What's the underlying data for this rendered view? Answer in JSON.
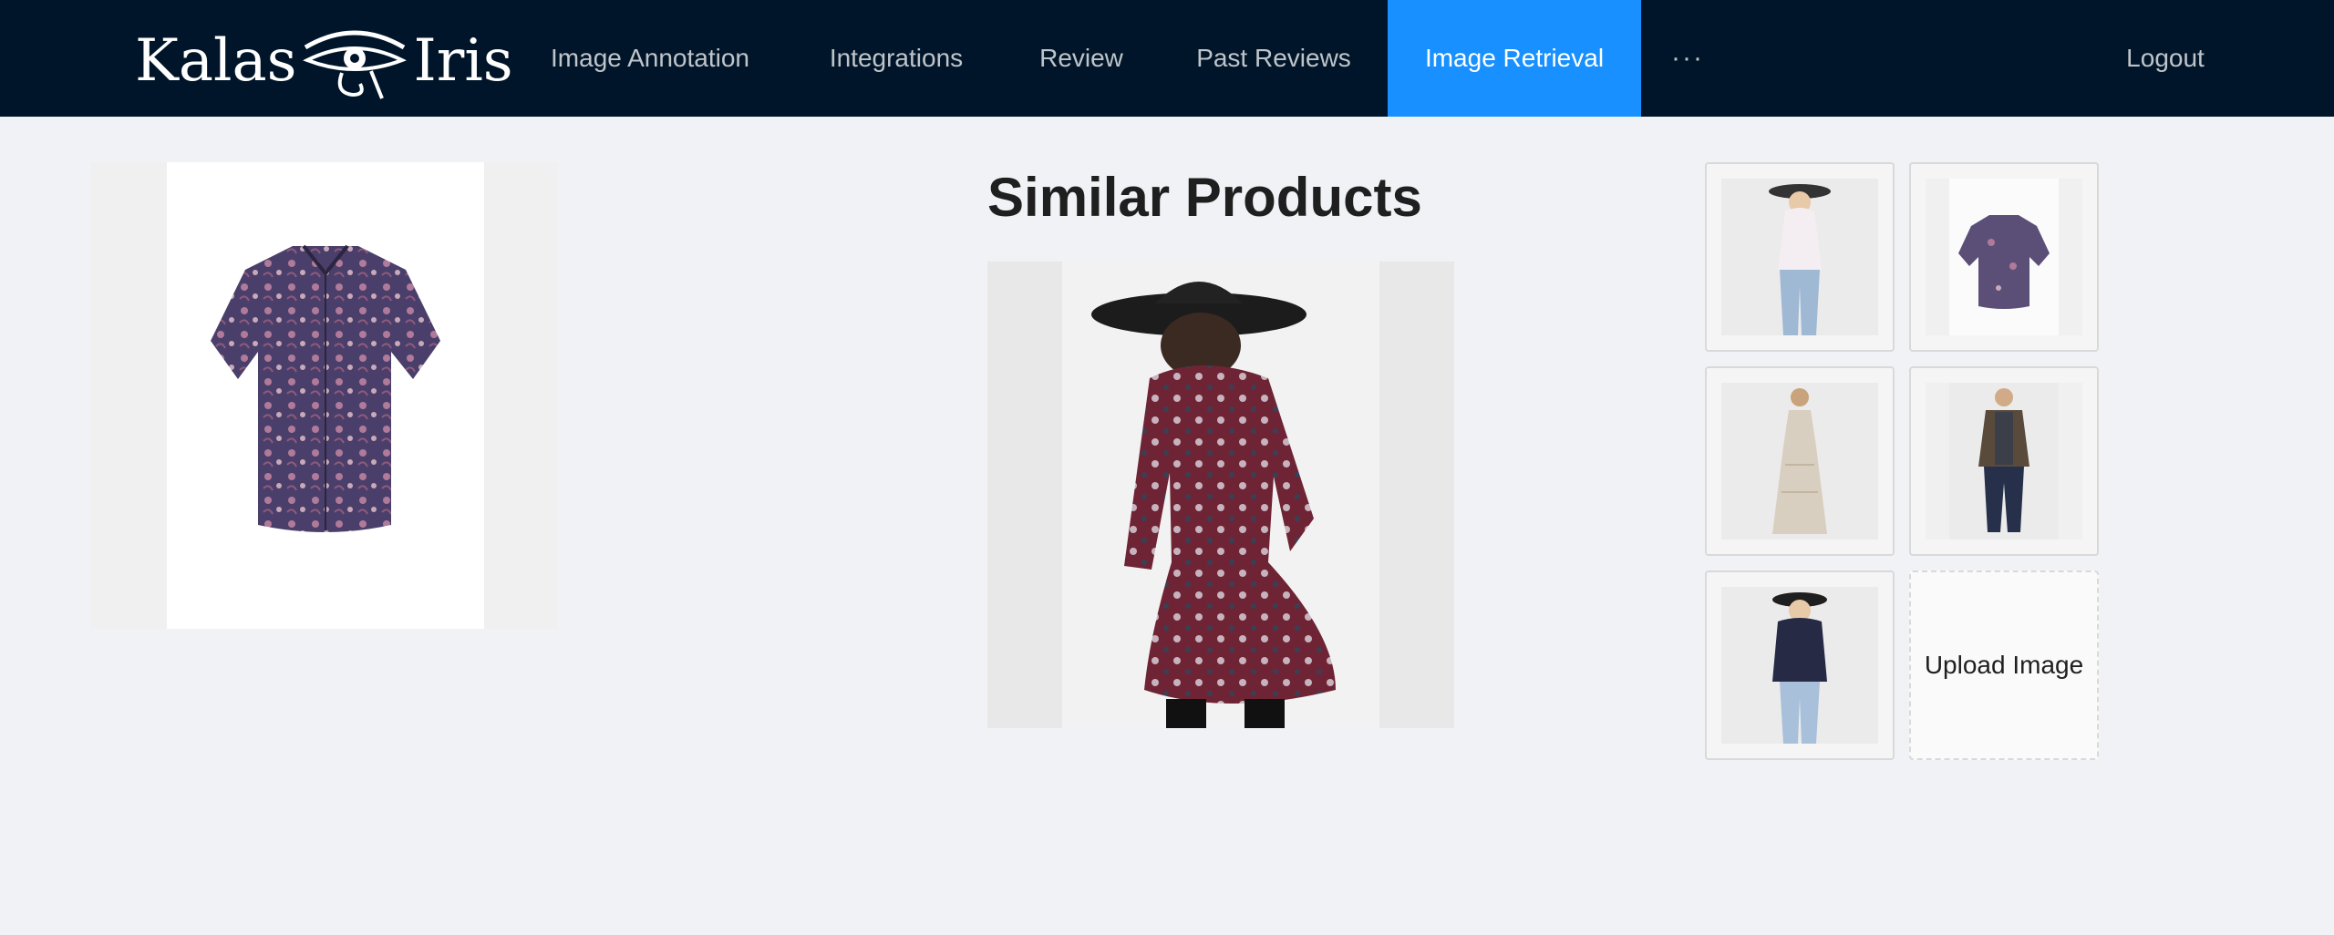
{
  "header": {
    "logo_left": "Kalas",
    "logo_right": "Iris",
    "nav": [
      {
        "label": "Image Annotation"
      },
      {
        "label": "Integrations"
      },
      {
        "label": "Review"
      },
      {
        "label": "Past Reviews"
      },
      {
        "label": "Image Retrieval",
        "active": true
      },
      {
        "label": "···"
      }
    ],
    "logout_label": "Logout"
  },
  "main": {
    "query_image": {
      "icon": "patterned-shirt-image"
    },
    "title": "Similar Products",
    "selected_product": {
      "icon": "woman-red-dress-hat-image"
    },
    "thumbnails": [
      {
        "icon": "woman-white-top-jeans-image"
      },
      {
        "icon": "patterned-shirt-image"
      },
      {
        "icon": "woman-long-lace-dress-image"
      },
      {
        "icon": "man-varsity-jacket-image"
      },
      {
        "icon": "woman-navy-lace-top-image"
      }
    ],
    "upload_label": "Upload Image"
  },
  "colors": {
    "header_bg": "#001529",
    "active_tab": "#1890ff",
    "page_bg": "#f0f2f5"
  }
}
